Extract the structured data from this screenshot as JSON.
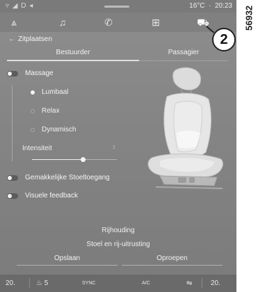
{
  "status_bar": {
    "left_icons": "▿ ◢ D ◂",
    "temperature": "16°C",
    "time": "20:23"
  },
  "nav": [
    {
      "name": "navigation-icon",
      "glyph": "⩓"
    },
    {
      "name": "music-icon",
      "glyph": "♫"
    },
    {
      "name": "phone-icon",
      "glyph": "✆"
    },
    {
      "name": "apps-grid-icon",
      "glyph": "⊞"
    },
    {
      "name": "car-icon",
      "glyph": "⛟"
    }
  ],
  "header": {
    "back_icon": "←",
    "title": "Zitplaatsen"
  },
  "tabs": {
    "driver": "Bestuurder",
    "passenger": "Passagier"
  },
  "massage": {
    "label": "Massage",
    "options": [
      "Lumbaal",
      "Relax",
      "Dynamisch"
    ],
    "selected": "Lumbaal",
    "intensity_label": "Intensiteit",
    "intensity_value": "2",
    "intensity_level": 0.6
  },
  "toggles": {
    "easy_access": "Gemakkelijke Stoeltoegang",
    "visual_feedback": "Visuele feedback"
  },
  "driving_position": {
    "title": "Rijhouding",
    "subtitle": "Stoel en rij-uitrusting",
    "save": "Opslaan",
    "recall": "Oproepen"
  },
  "climate": {
    "left_temp": "20.",
    "left_seat": "5",
    "sync": "SYNC",
    "ac": "A/C",
    "right_temp": "20."
  },
  "callout": {
    "number": "2"
  },
  "reference": "56932",
  "colors": {
    "screen_bg": "#858585",
    "highlight": "#f5f5f5"
  }
}
